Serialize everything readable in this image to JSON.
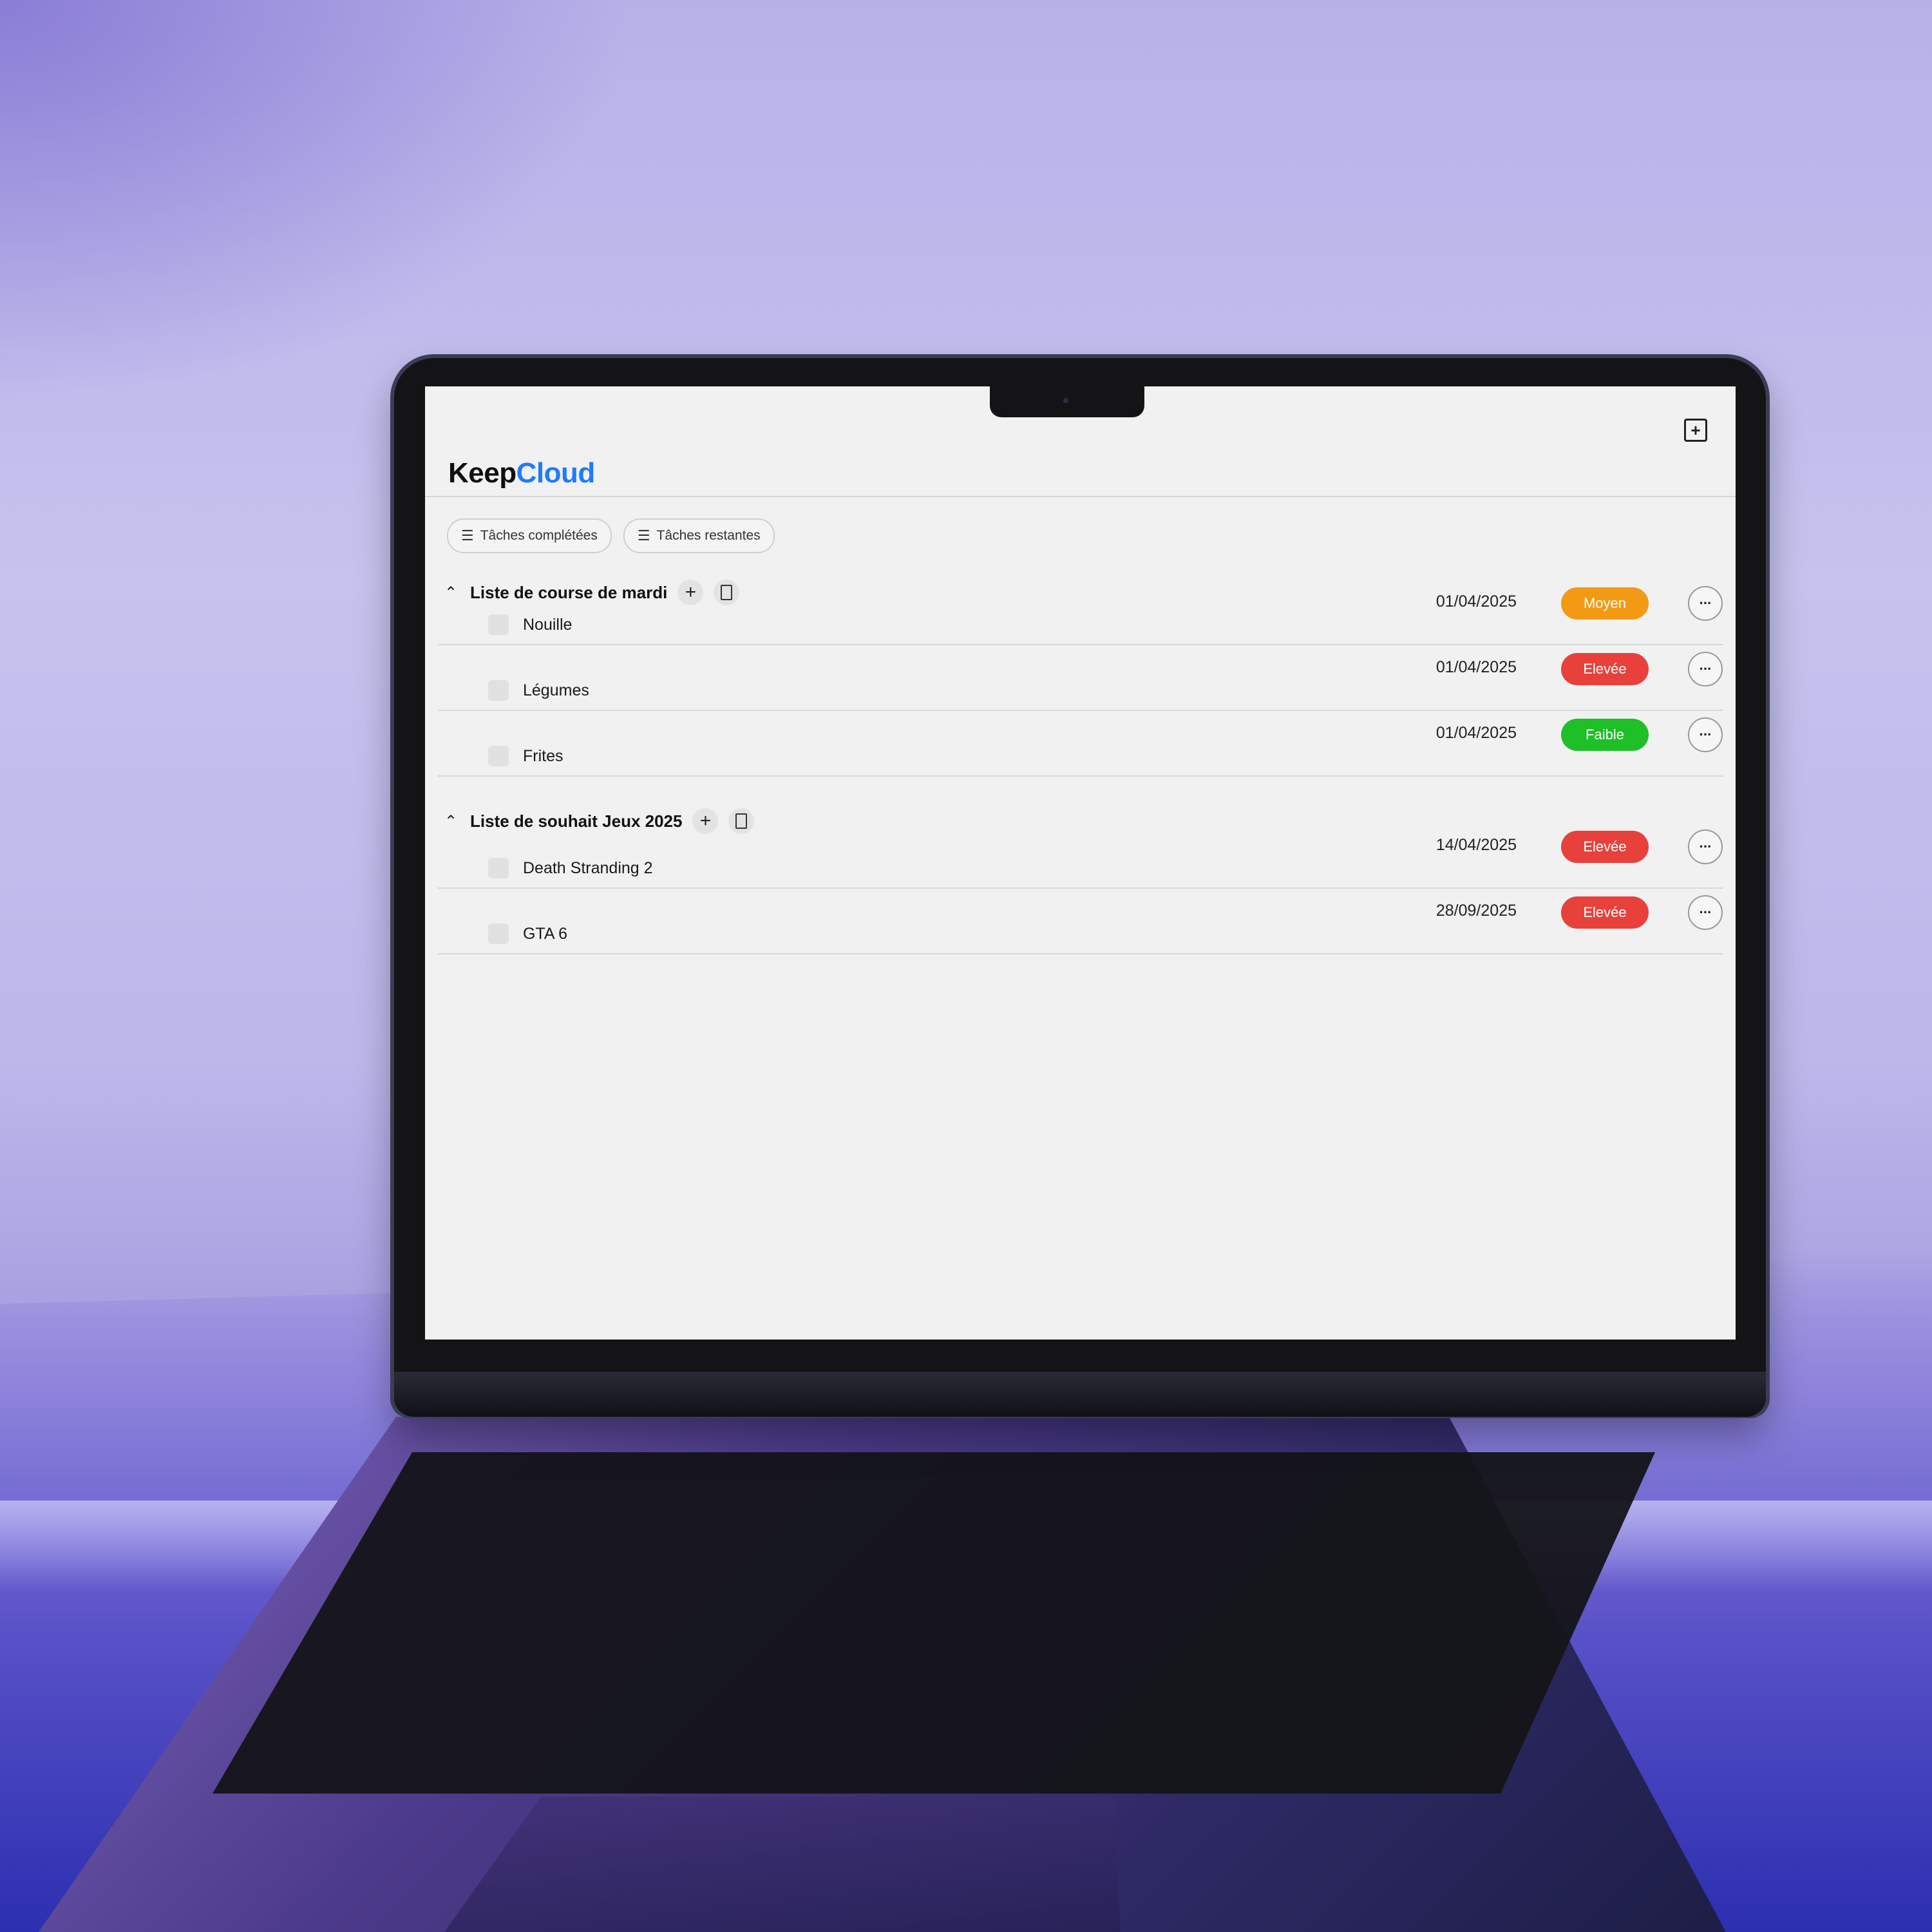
{
  "app": {
    "logo_part1": "Keep",
    "logo_part2": "Cloud",
    "brand_color": "#1e7bff",
    "new_icon": "plus-square-icon"
  },
  "filters": [
    {
      "label": "Tâches complétées",
      "icon": "list-check-icon"
    },
    {
      "label": "Tâches restantes",
      "icon": "list-icon"
    }
  ],
  "groups": [
    {
      "title": "Liste de course de mardi",
      "tasks": [
        {
          "name": "Nouille",
          "date": "01/04/2025",
          "priority": "Moyen",
          "color": "#f39a14"
        },
        {
          "name": "Légumes",
          "date": "01/04/2025",
          "priority": "Elevée",
          "color": "#e8413c"
        },
        {
          "name": "Frites",
          "date": "01/04/2025",
          "priority": "Faible",
          "color": "#1fbf27"
        }
      ]
    },
    {
      "title": "Liste de souhait Jeux 2025",
      "tasks": [
        {
          "name": "Death Stranding 2",
          "date": "14/04/2025",
          "priority": "Elevée",
          "color": "#e8413c"
        },
        {
          "name": "GTA 6",
          "date": "28/09/2025",
          "priority": "Elevée",
          "color": "#e8413c"
        }
      ]
    }
  ]
}
